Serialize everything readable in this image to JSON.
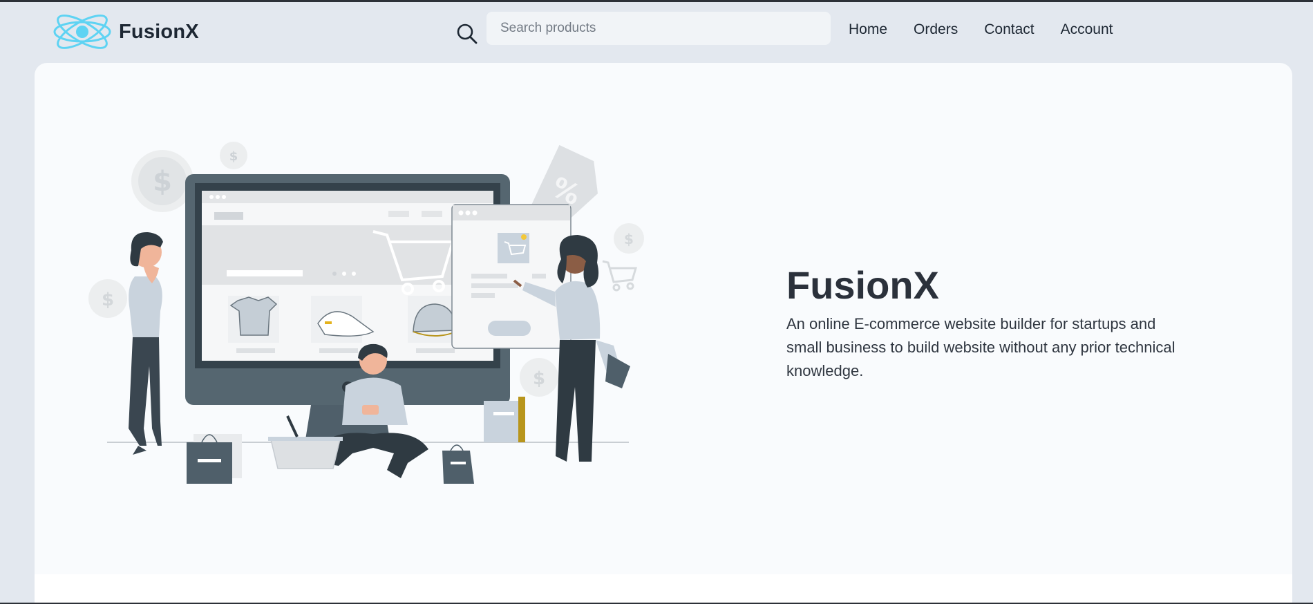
{
  "header": {
    "brand_name": "FusionX",
    "search": {
      "placeholder": "Search products",
      "value": ""
    },
    "nav": [
      "Home",
      "Orders",
      "Contact",
      "Account"
    ]
  },
  "hero": {
    "title": "FusionX",
    "description": "An online E-commerce website builder for startups and small business to build website without any prior technical knowledge."
  },
  "icons": {
    "logo": "atom-logo-icon",
    "search": "search-icon"
  },
  "colors": {
    "page_bg": "#e3e8ef",
    "card_bg": "#f9fbfd",
    "text_dark": "#1d2733",
    "logo_accent": "#5ed3f3",
    "illustration_dark": "#4f5f6a",
    "illustration_light": "#c9d3dd",
    "illustration_accent": "#b8951c"
  }
}
